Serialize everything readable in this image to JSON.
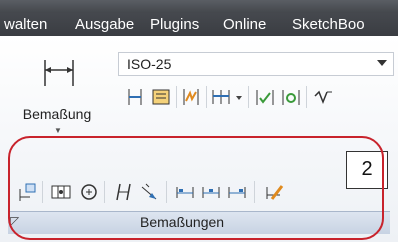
{
  "menu": [
    "walten",
    "Ausgabe",
    "Plugins",
    "Online",
    "SketchBoo"
  ],
  "dimension_button": {
    "label": "Bemaßung"
  },
  "dim_style": {
    "value": "ISO-25"
  },
  "panel": {
    "title": "Bemaßungen",
    "badge": "2"
  },
  "colors": {
    "highlight": "#c8232c",
    "icon_blue": "#2f6fb3",
    "icon_orange": "#e08a1e",
    "icon_green": "#3a9a3a"
  }
}
